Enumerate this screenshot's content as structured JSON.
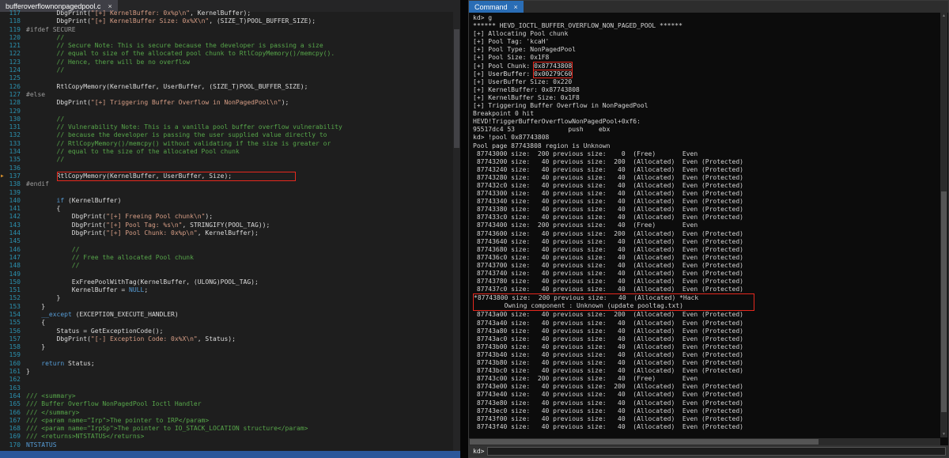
{
  "colors": {
    "annotation_red": "#e5281e",
    "editor_status_strip": "#2b579a",
    "debugger_tab_blue": "#2a6db5",
    "line_number_blue": "#2b91af"
  },
  "editor": {
    "tab_title": "bufferoverflownonpagedpool.c",
    "close_glyph": "×",
    "lines": [
      {
        "n": 117,
        "seg": [
          [
            "p",
            "        DbgPrint("
          ],
          [
            "s",
            "\"[+] KernelBuffer: 0x%p\\n\""
          ],
          [
            "p",
            ", KernelBuffer);"
          ]
        ]
      },
      {
        "n": 118,
        "seg": [
          [
            "p",
            "        DbgPrint("
          ],
          [
            "s",
            "\"[+] KernelBuffer Size: 0x%X\\n\""
          ],
          [
            "p",
            ", (SIZE_T)POOL_BUFFER_SIZE);"
          ]
        ]
      },
      {
        "n": 119,
        "seg": [
          [
            "pp",
            "#ifdef SECURE"
          ]
        ]
      },
      {
        "n": 120,
        "seg": [
          [
            "c",
            "        //"
          ]
        ]
      },
      {
        "n": 121,
        "seg": [
          [
            "c",
            "        // Secure Note: This is secure because the developer is passing a size"
          ]
        ]
      },
      {
        "n": 122,
        "seg": [
          [
            "c",
            "        // equal to size of the allocated pool chunk to RtlCopyMemory()/memcpy()."
          ]
        ]
      },
      {
        "n": 123,
        "seg": [
          [
            "c",
            "        // Hence, there will be no overflow"
          ]
        ]
      },
      {
        "n": 124,
        "seg": [
          [
            "c",
            "        //"
          ]
        ]
      },
      {
        "n": 125,
        "seg": []
      },
      {
        "n": 126,
        "seg": [
          [
            "p",
            "        RtlCopyMemory(KernelBuffer, UserBuffer, (SIZE_T)POOL_BUFFER_SIZE);"
          ]
        ]
      },
      {
        "n": 127,
        "seg": [
          [
            "pp",
            "#else"
          ]
        ]
      },
      {
        "n": 128,
        "seg": [
          [
            "p",
            "        DbgPrint("
          ],
          [
            "s",
            "\"[+] Triggering Buffer Overflow in NonPagedPool\\n\""
          ],
          [
            "p",
            ");"
          ]
        ]
      },
      {
        "n": 129,
        "seg": []
      },
      {
        "n": 130,
        "seg": [
          [
            "c",
            "        //"
          ]
        ]
      },
      {
        "n": 131,
        "seg": [
          [
            "c",
            "        // Vulnerability Note: This is a vanilla pool buffer overflow vulnerability"
          ]
        ]
      },
      {
        "n": 132,
        "seg": [
          [
            "c",
            "        // because the developer is passing the user supplied value directly to"
          ]
        ]
      },
      {
        "n": 133,
        "seg": [
          [
            "c",
            "        // RtlCopyMemory()/memcpy() without validating if the size is greater or"
          ]
        ]
      },
      {
        "n": 134,
        "seg": [
          [
            "c",
            "        // equal to the size of the allocated Pool chunk"
          ]
        ]
      },
      {
        "n": 135,
        "seg": [
          [
            "c",
            "        //"
          ]
        ]
      },
      {
        "n": 136,
        "seg": []
      },
      {
        "n": 137,
        "mark": true,
        "box": true,
        "seg": [
          [
            "p",
            "        RtlCopyMemory(KernelBuffer, UserBuffer, Size);"
          ]
        ]
      },
      {
        "n": 138,
        "seg": [
          [
            "pp",
            "#endif"
          ]
        ]
      },
      {
        "n": 139,
        "seg": []
      },
      {
        "n": 140,
        "seg": [
          [
            "p",
            "        "
          ],
          [
            "k",
            "if"
          ],
          [
            "p",
            " (KernelBuffer)"
          ]
        ]
      },
      {
        "n": 141,
        "seg": [
          [
            "p",
            "        {"
          ]
        ]
      },
      {
        "n": 142,
        "seg": [
          [
            "p",
            "            DbgPrint("
          ],
          [
            "s",
            "\"[+] Freeing Pool chunk\\n\""
          ],
          [
            "p",
            ");"
          ]
        ]
      },
      {
        "n": 143,
        "seg": [
          [
            "p",
            "            DbgPrint("
          ],
          [
            "s",
            "\"[+] Pool Tag: %s\\n\""
          ],
          [
            "p",
            ", STRINGIFY(POOL_TAG));"
          ]
        ]
      },
      {
        "n": 144,
        "seg": [
          [
            "p",
            "            DbgPrint("
          ],
          [
            "s",
            "\"[+] Pool Chunk: 0x%p\\n\""
          ],
          [
            "p",
            ", KernelBuffer);"
          ]
        ]
      },
      {
        "n": 145,
        "seg": []
      },
      {
        "n": 146,
        "seg": [
          [
            "c",
            "            //"
          ]
        ]
      },
      {
        "n": 147,
        "seg": [
          [
            "c",
            "            // Free the allocated Pool chunk"
          ]
        ]
      },
      {
        "n": 148,
        "seg": [
          [
            "c",
            "            //"
          ]
        ]
      },
      {
        "n": 149,
        "seg": []
      },
      {
        "n": 150,
        "seg": [
          [
            "p",
            "            ExFreePoolWithTag(KernelBuffer, (ULONG)POOL_TAG);"
          ]
        ]
      },
      {
        "n": 151,
        "seg": [
          [
            "p",
            "            KernelBuffer = "
          ],
          [
            "k",
            "NULL"
          ],
          [
            "p",
            ";"
          ]
        ]
      },
      {
        "n": 152,
        "seg": [
          [
            "p",
            "        }"
          ]
        ]
      },
      {
        "n": 153,
        "seg": [
          [
            "p",
            "    }"
          ]
        ]
      },
      {
        "n": 154,
        "seg": [
          [
            "p",
            "    "
          ],
          [
            "k",
            "__except"
          ],
          [
            "p",
            " (EXCEPTION_EXECUTE_HANDLER)"
          ]
        ]
      },
      {
        "n": 155,
        "seg": [
          [
            "p",
            "    {"
          ]
        ]
      },
      {
        "n": 156,
        "seg": [
          [
            "p",
            "        Status = GetExceptionCode();"
          ]
        ]
      },
      {
        "n": 157,
        "seg": [
          [
            "p",
            "        DbgPrint("
          ],
          [
            "s",
            "\"[-] Exception Code: 0x%X\\n\""
          ],
          [
            "p",
            ", Status);"
          ]
        ]
      },
      {
        "n": 158,
        "seg": [
          [
            "p",
            "    }"
          ]
        ]
      },
      {
        "n": 159,
        "seg": []
      },
      {
        "n": 160,
        "seg": [
          [
            "p",
            "    "
          ],
          [
            "k",
            "return"
          ],
          [
            "p",
            " Status;"
          ]
        ]
      },
      {
        "n": 161,
        "seg": [
          [
            "p",
            "}"
          ]
        ]
      },
      {
        "n": 162,
        "seg": []
      },
      {
        "n": 163,
        "seg": []
      },
      {
        "n": 164,
        "seg": [
          [
            "c",
            "/// <summary>"
          ]
        ]
      },
      {
        "n": 165,
        "seg": [
          [
            "c",
            "/// Buffer Overflow NonPagedPool Ioctl Handler"
          ]
        ]
      },
      {
        "n": 166,
        "seg": [
          [
            "c",
            "/// </summary>"
          ]
        ]
      },
      {
        "n": 167,
        "seg": [
          [
            "c",
            "/// <param name=\"Irp\">The pointer to IRP</param>"
          ]
        ]
      },
      {
        "n": 168,
        "seg": [
          [
            "c",
            "/// <param name=\"IrpSp\">The pointer to IO_STACK_LOCATION structure</param>"
          ]
        ]
      },
      {
        "n": 169,
        "seg": [
          [
            "c",
            "/// <returns>NTSTATUS</returns>"
          ]
        ]
      },
      {
        "n": 170,
        "seg": [
          [
            "k",
            "NTSTATUS"
          ]
        ]
      }
    ]
  },
  "debugger": {
    "tab_title": "Command",
    "close_glyph": "×",
    "prompt": "kd>",
    "input_value": "",
    "scroll_up_glyph": "▲",
    "scroll_down_glyph": "▼",
    "lines": [
      {
        "t": "kd> g"
      },
      {
        "t": "****** HEVD_IOCTL_BUFFER_OVERFLOW_NON_PAGED_POOL ******"
      },
      {
        "t": "[+] Allocating Pool chunk"
      },
      {
        "t": "[+] Pool Tag: 'kcaH'"
      },
      {
        "t": "[+] Pool Type: NonPagedPool"
      },
      {
        "t": "[+] Pool Size: 0x1F8"
      },
      {
        "seg": [
          [
            "p",
            "[+] Pool Chunk: "
          ],
          [
            "rb",
            "0x87743808"
          ]
        ]
      },
      {
        "seg": [
          [
            "p",
            "[+] UserBuffer: "
          ],
          [
            "rb",
            "0x00279C60"
          ]
        ]
      },
      {
        "t": "[+] UserBuffer Size: 0x220"
      },
      {
        "t": "[+] KernelBuffer: 0x87743808"
      },
      {
        "t": "[+] KernelBuffer Size: 0x1F8"
      },
      {
        "t": "[+] Triggering Buffer Overflow in NonPagedPool"
      },
      {
        "t": "Breakpoint 0 hit"
      },
      {
        "t": "HEVD!TriggerBufferOverflowNonPagedPool+0xf6:"
      },
      {
        "t": "95517dc4 53              push    ebx"
      },
      {
        "t": "kd> !pool 0x87743808"
      },
      {
        "t": "Pool page 87743808 region is Unknown"
      },
      {
        "t": " 87743000 size:  200 previous size:    0  (Free)       Even"
      },
      {
        "t": " 87743200 size:   40 previous size:  200  (Allocated)  Even (Protected)"
      },
      {
        "t": " 87743240 size:   40 previous size:   40  (Allocated)  Even (Protected)"
      },
      {
        "t": " 87743280 size:   40 previous size:   40  (Allocated)  Even (Protected)"
      },
      {
        "t": " 877432c0 size:   40 previous size:   40  (Allocated)  Even (Protected)"
      },
      {
        "t": " 87743300 size:   40 previous size:   40  (Allocated)  Even (Protected)"
      },
      {
        "t": " 87743340 size:   40 previous size:   40  (Allocated)  Even (Protected)"
      },
      {
        "t": " 87743380 size:   40 previous size:   40  (Allocated)  Even (Protected)"
      },
      {
        "t": " 877433c0 size:   40 previous size:   40  (Allocated)  Even (Protected)"
      },
      {
        "t": " 87743400 size:  200 previous size:   40  (Free)       Even"
      },
      {
        "t": " 87743600 size:   40 previous size:  200  (Allocated)  Even (Protected)"
      },
      {
        "t": " 87743640 size:   40 previous size:   40  (Allocated)  Even (Protected)"
      },
      {
        "t": " 87743680 size:   40 previous size:   40  (Allocated)  Even (Protected)"
      },
      {
        "t": " 877436c0 size:   40 previous size:   40  (Allocated)  Even (Protected)"
      },
      {
        "t": " 87743700 size:   40 previous size:   40  (Allocated)  Even (Protected)"
      },
      {
        "t": " 87743740 size:   40 previous size:   40  (Allocated)  Even (Protected)"
      },
      {
        "t": " 87743780 size:   40 previous size:   40  (Allocated)  Even (Protected)"
      },
      {
        "t": " 877437c0 size:   40 previous size:   40  (Allocated)  Even (Protected)"
      },
      {
        "t": "*87743800 size:  200 previous size:   40  (Allocated) *Hack",
        "g": "box"
      },
      {
        "t": "        Owning component : Unknown (update pooltag.txt)",
        "g": "box"
      },
      {
        "t": " 87743a00 size:   40 previous size:  200  (Allocated)  Even (Protected)"
      },
      {
        "t": " 87743a40 size:   40 previous size:   40  (Allocated)  Even (Protected)"
      },
      {
        "t": " 87743a80 size:   40 previous size:   40  (Allocated)  Even (Protected)"
      },
      {
        "t": " 87743ac0 size:   40 previous size:   40  (Allocated)  Even (Protected)"
      },
      {
        "t": " 87743b00 size:   40 previous size:   40  (Allocated)  Even (Protected)"
      },
      {
        "t": " 87743b40 size:   40 previous size:   40  (Allocated)  Even (Protected)"
      },
      {
        "t": " 87743b80 size:   40 previous size:   40  (Allocated)  Even (Protected)"
      },
      {
        "t": " 87743bc0 size:   40 previous size:   40  (Allocated)  Even (Protected)"
      },
      {
        "t": " 87743c00 size:  200 previous size:   40  (Free)       Even"
      },
      {
        "t": " 87743e00 size:   40 previous size:  200  (Allocated)  Even (Protected)"
      },
      {
        "t": " 87743e40 size:   40 previous size:   40  (Allocated)  Even (Protected)"
      },
      {
        "t": " 87743e80 size:   40 previous size:   40  (Allocated)  Even (Protected)"
      },
      {
        "t": " 87743ec0 size:   40 previous size:   40  (Allocated)  Even (Protected)"
      },
      {
        "t": " 87743f00 size:   40 previous size:   40  (Allocated)  Even (Protected)"
      },
      {
        "t": " 87743f40 size:   40 previous size:   40  (Allocated)  Even (Protected)"
      }
    ]
  }
}
